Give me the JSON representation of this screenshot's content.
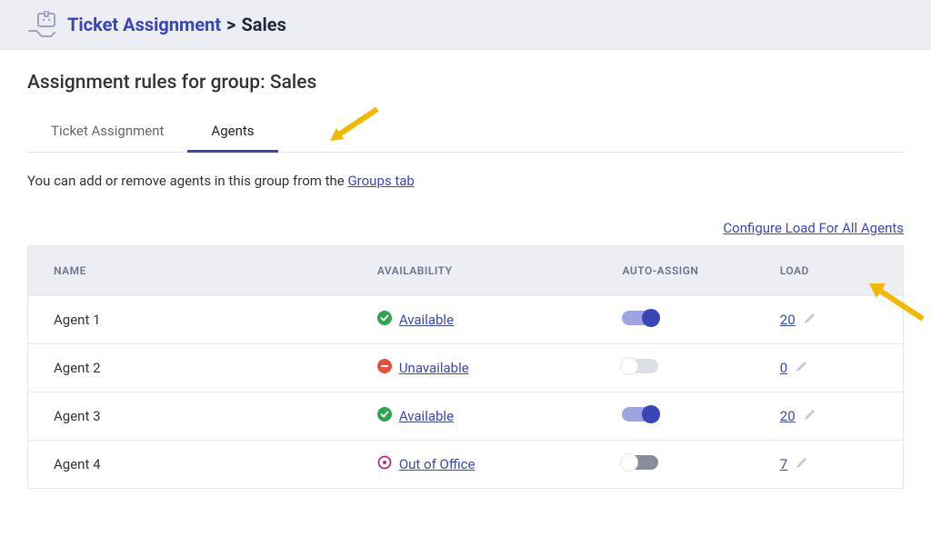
{
  "header": {
    "breadcrumb_link": "Ticket Assignment",
    "breadcrumb_sep": ">",
    "breadcrumb_current": "Sales"
  },
  "page": {
    "heading": "Assignment rules for group: Sales"
  },
  "tabs": {
    "items": [
      {
        "label": "Ticket Assignment",
        "active": false
      },
      {
        "label": "Agents",
        "active": true
      }
    ]
  },
  "helper": {
    "text_before": "You can add or remove agents in this group from the ",
    "link_text": "Groups tab"
  },
  "configure_link": "Configure Load For All Agents",
  "table": {
    "columns": {
      "name": "NAME",
      "availability": "AVAILABILITY",
      "auto_assign": "AUTO-ASSIGN",
      "load": "LOAD"
    },
    "rows": [
      {
        "name": "Agent 1",
        "status_icon": "check-circle-green",
        "status_label": "Available",
        "toggle": "on",
        "load": "20"
      },
      {
        "name": "Agent 2",
        "status_icon": "minus-circle-red",
        "status_label": "Unavailable",
        "toggle": "off",
        "load": "0"
      },
      {
        "name": "Agent 3",
        "status_icon": "check-circle-green",
        "status_label": "Available",
        "toggle": "on",
        "load": "20"
      },
      {
        "name": "Agent 4",
        "status_icon": "clock-outline-magenta",
        "status_label": "Out of Office",
        "toggle": "off-dark",
        "load": "7"
      }
    ]
  },
  "colors": {
    "brand": "#3846b8",
    "green": "#2da44e",
    "red": "#e3503e",
    "magenta": "#b82e7c"
  }
}
